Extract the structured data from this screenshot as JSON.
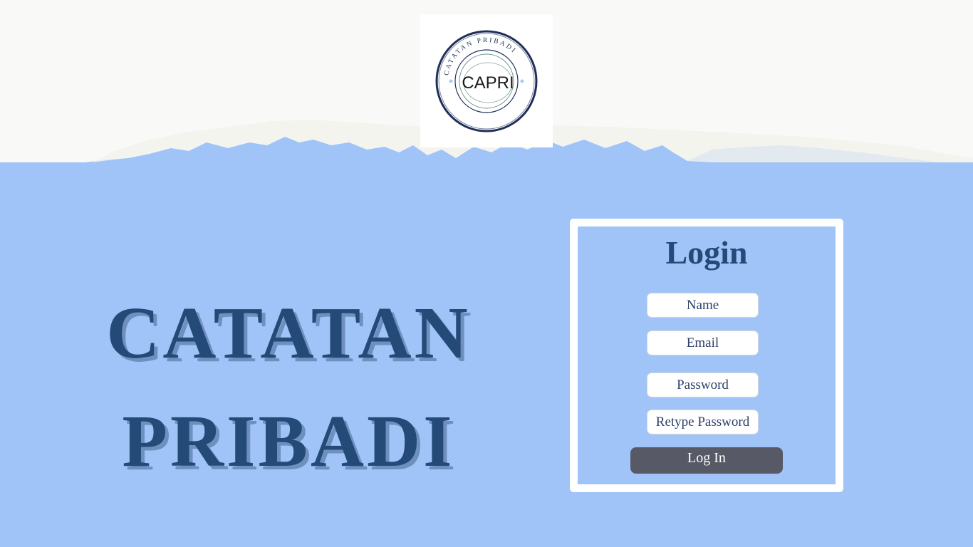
{
  "logo": {
    "ring_text": "CATATAN PRIBADI",
    "center_text": "CAPRI"
  },
  "hero": {
    "line1": "CATATAN",
    "line2": "PRIBADI"
  },
  "login": {
    "title": "Login",
    "name_placeholder": "Name",
    "email_placeholder": "Email",
    "password_placeholder": "Password",
    "retype_placeholder": "Retype Password",
    "button_label": "Log In"
  },
  "colors": {
    "background": "#a0c4f8",
    "title_text": "#244a78",
    "title_shadow": "#6f8fbf",
    "panel_border": "#ffffff",
    "button_bg": "#575a66",
    "button_text": "#ffffff",
    "top_band": "#f9f9f7"
  }
}
